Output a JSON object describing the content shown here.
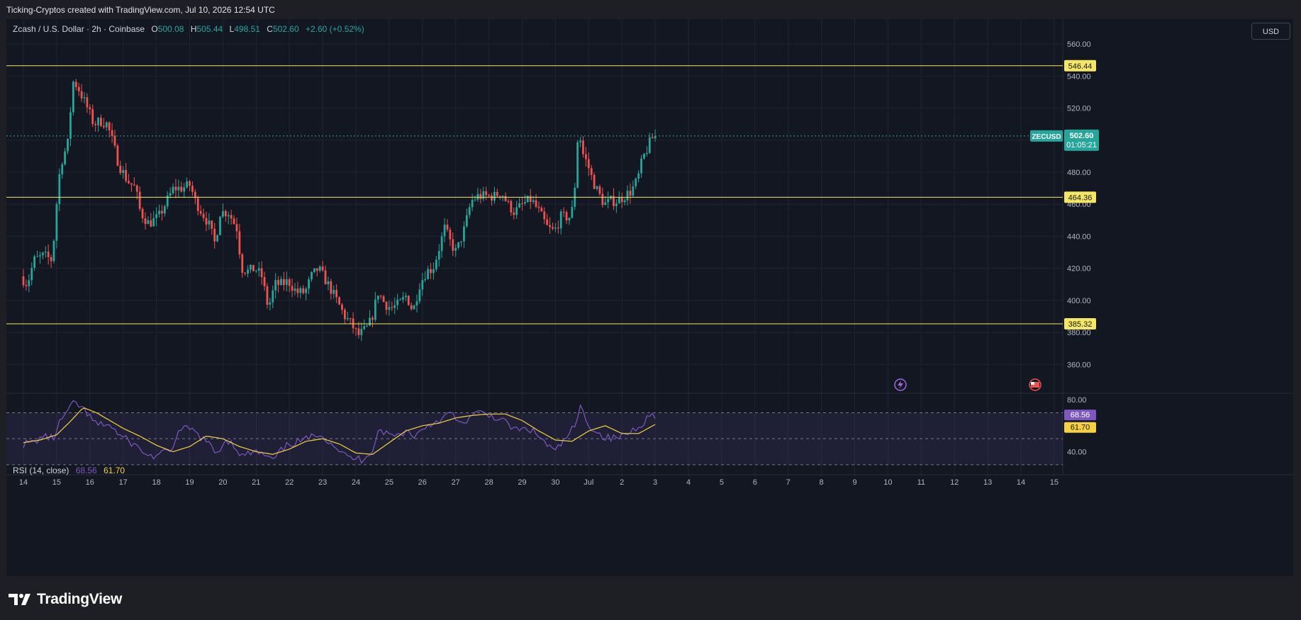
{
  "header": {
    "attribution": "Ticking-Cryptos created with TradingView.com, Jul 10, 2026 12:54 UTC"
  },
  "symbol": {
    "name": "Zcash / U.S. Dollar · 2h · Coinbase",
    "open_label": "O",
    "open": "500.08",
    "high_label": "H",
    "high": "505.44",
    "low_label": "L",
    "low": "498.51",
    "close_label": "C",
    "close": "502.60",
    "change": "+2.60 (+0.52%)",
    "ticker": "ZECUSD",
    "last_price": "502.60",
    "countdown": "01:05:21"
  },
  "currency_button": "USD",
  "footer": {
    "logo_text": "TradingView"
  },
  "colors": {
    "background": "#131722",
    "up": "#26a69a",
    "down": "#ef5350",
    "level_line": "#f5e663",
    "rsi_line": "#7e57c2",
    "rsi_ma": "#f5d142"
  },
  "chart_data": [
    {
      "type": "candlestick",
      "title": "Zcash / U.S. Dollar · 2h · Coinbase",
      "y_ticks": [
        "560.00",
        "540.00",
        "520.00",
        "500.00",
        "480.00",
        "460.00",
        "440.00",
        "420.00",
        "400.00",
        "380.00",
        "360.00"
      ],
      "ylim": [
        342,
        572
      ],
      "x_ticks": [
        "14",
        "15",
        "16",
        "17",
        "18",
        "19",
        "20",
        "21",
        "22",
        "23",
        "24",
        "25",
        "26",
        "27",
        "28",
        "29",
        "30",
        "Jul",
        "2",
        "3",
        "4",
        "5",
        "6",
        "7",
        "8",
        "9",
        "10",
        "11",
        "12",
        "13",
        "14",
        "15"
      ],
      "horizontal_levels": [
        {
          "value": 546.44,
          "label": "546.44"
        },
        {
          "value": 464.36,
          "label": "464.36"
        },
        {
          "value": 385.32,
          "label": "385.32"
        }
      ],
      "last_price": 502.6,
      "price_anchors": [
        [
          0,
          415
        ],
        [
          0.2,
          410
        ],
        [
          0.4,
          425
        ],
        [
          0.7,
          428
        ],
        [
          0.95,
          425
        ],
        [
          1.1,
          465
        ],
        [
          1.2,
          485
        ],
        [
          1.45,
          500
        ],
        [
          1.55,
          537
        ],
        [
          1.7,
          534
        ],
        [
          1.9,
          525
        ],
        [
          2.05,
          518
        ],
        [
          2.2,
          510
        ],
        [
          2.4,
          512
        ],
        [
          2.6,
          510
        ],
        [
          2.75,
          500
        ],
        [
          2.95,
          485
        ],
        [
          3.2,
          475
        ],
        [
          3.45,
          470
        ],
        [
          3.6,
          455
        ],
        [
          3.85,
          448
        ],
        [
          4.15,
          452
        ],
        [
          4.35,
          460
        ],
        [
          4.6,
          470
        ],
        [
          4.85,
          470
        ],
        [
          5.1,
          472
        ],
        [
          5.25,
          462
        ],
        [
          5.45,
          455
        ],
        [
          5.65,
          448
        ],
        [
          5.85,
          435
        ],
        [
          6.0,
          455
        ],
        [
          6.25,
          455
        ],
        [
          6.5,
          445
        ],
        [
          6.65,
          420
        ],
        [
          6.85,
          418
        ],
        [
          7.05,
          420
        ],
        [
          7.25,
          415
        ],
        [
          7.45,
          395
        ],
        [
          7.65,
          410
        ],
        [
          7.85,
          410
        ],
        [
          8.05,
          412
        ],
        [
          8.3,
          405
        ],
        [
          8.55,
          405
        ],
        [
          8.75,
          415
        ],
        [
          8.95,
          420
        ],
        [
          9.1,
          415
        ],
        [
          9.3,
          408
        ],
        [
          9.5,
          400
        ],
        [
          9.75,
          390
        ],
        [
          9.95,
          385
        ],
        [
          10.15,
          378
        ],
        [
          10.4,
          382
        ],
        [
          10.55,
          388
        ],
        [
          10.75,
          405
        ],
        [
          10.95,
          398
        ],
        [
          11.15,
          395
        ],
        [
          11.4,
          398
        ],
        [
          11.6,
          403
        ],
        [
          11.8,
          393
        ],
        [
          12.0,
          410
        ],
        [
          12.2,
          418
        ],
        [
          12.4,
          420
        ],
        [
          12.55,
          430
        ],
        [
          12.75,
          445
        ],
        [
          12.95,
          435
        ],
        [
          13.1,
          430
        ],
        [
          13.35,
          445
        ],
        [
          13.55,
          462
        ],
        [
          13.75,
          465
        ],
        [
          14.0,
          465
        ],
        [
          14.25,
          465
        ],
        [
          14.45,
          468
        ],
        [
          14.65,
          460
        ],
        [
          14.85,
          455
        ],
        [
          15.1,
          460
        ],
        [
          15.35,
          463
        ],
        [
          15.6,
          455
        ],
        [
          15.85,
          445
        ],
        [
          16.05,
          443
        ],
        [
          16.25,
          452
        ],
        [
          16.5,
          452
        ],
        [
          16.65,
          460
        ],
        [
          16.7,
          495
        ],
        [
          16.8,
          505
        ],
        [
          16.9,
          492
        ],
        [
          17.05,
          485
        ],
        [
          17.2,
          475
        ],
        [
          17.35,
          468
        ],
        [
          17.55,
          460
        ],
        [
          17.75,
          462
        ],
        [
          17.95,
          462
        ],
        [
          18.15,
          465
        ],
        [
          18.35,
          468
        ],
        [
          18.55,
          475
        ],
        [
          18.7,
          488
        ],
        [
          18.85,
          495
        ],
        [
          18.95,
          500
        ],
        [
          19.05,
          502.6
        ]
      ],
      "rsi": {
        "label": "RSI (14, close)",
        "value": 68.56,
        "ma_value": 61.7,
        "value_label": "68.56",
        "ma_label": "61.70",
        "y_ticks": [
          "80.00",
          "40.00"
        ],
        "ylim": [
          25,
          85
        ],
        "bands": [
          70,
          50,
          30
        ],
        "anchors": [
          [
            0,
            46
          ],
          [
            0.3,
            47
          ],
          [
            0.6,
            52
          ],
          [
            0.9,
            50
          ],
          [
            1.1,
            63
          ],
          [
            1.3,
            70
          ],
          [
            1.55,
            78
          ],
          [
            1.7,
            75
          ],
          [
            1.9,
            70
          ],
          [
            2.1,
            63
          ],
          [
            2.3,
            60
          ],
          [
            2.5,
            62
          ],
          [
            2.7,
            58
          ],
          [
            2.9,
            52
          ],
          [
            3.2,
            48
          ],
          [
            3.5,
            42
          ],
          [
            3.8,
            36
          ],
          [
            4.1,
            38
          ],
          [
            4.4,
            40
          ],
          [
            4.7,
            56
          ],
          [
            5.0,
            58
          ],
          [
            5.3,
            52
          ],
          [
            5.5,
            48
          ],
          [
            5.8,
            38
          ],
          [
            6.1,
            50
          ],
          [
            6.3,
            46
          ],
          [
            6.6,
            36
          ],
          [
            6.9,
            40
          ],
          [
            7.2,
            38
          ],
          [
            7.5,
            33
          ],
          [
            7.8,
            42
          ],
          [
            8.0,
            46
          ],
          [
            8.3,
            48
          ],
          [
            8.6,
            50
          ],
          [
            8.9,
            55
          ],
          [
            9.1,
            50
          ],
          [
            9.4,
            44
          ],
          [
            9.7,
            36
          ],
          [
            9.9,
            35
          ],
          [
            10.2,
            34
          ],
          [
            10.5,
            42
          ],
          [
            10.7,
            58
          ],
          [
            10.9,
            54
          ],
          [
            11.2,
            52
          ],
          [
            11.5,
            56
          ],
          [
            11.8,
            52
          ],
          [
            12.0,
            58
          ],
          [
            12.3,
            62
          ],
          [
            12.6,
            66
          ],
          [
            12.9,
            70
          ],
          [
            13.1,
            60
          ],
          [
            13.4,
            66
          ],
          [
            13.7,
            70
          ],
          [
            14.0,
            68
          ],
          [
            14.3,
            66
          ],
          [
            14.6,
            60
          ],
          [
            14.9,
            56
          ],
          [
            15.2,
            58
          ],
          [
            15.5,
            52
          ],
          [
            15.8,
            44
          ],
          [
            16.0,
            40
          ],
          [
            16.3,
            50
          ],
          [
            16.6,
            60
          ],
          [
            16.75,
            74
          ],
          [
            16.9,
            66
          ],
          [
            17.1,
            58
          ],
          [
            17.4,
            52
          ],
          [
            17.7,
            50
          ],
          [
            18.0,
            52
          ],
          [
            18.3,
            56
          ],
          [
            18.6,
            62
          ],
          [
            18.85,
            68
          ],
          [
            19.05,
            68.56
          ]
        ],
        "ma_anchors": [
          [
            0,
            47
          ],
          [
            0.5,
            49
          ],
          [
            1.0,
            53
          ],
          [
            1.4,
            63
          ],
          [
            1.8,
            74
          ],
          [
            2.2,
            70
          ],
          [
            2.6,
            64
          ],
          [
            3.0,
            58
          ],
          [
            3.5,
            52
          ],
          [
            4.0,
            45
          ],
          [
            4.5,
            40
          ],
          [
            5.0,
            44
          ],
          [
            5.5,
            52
          ],
          [
            6.0,
            50
          ],
          [
            6.5,
            44
          ],
          [
            7.0,
            40
          ],
          [
            7.5,
            38
          ],
          [
            8.0,
            42
          ],
          [
            8.5,
            48
          ],
          [
            9.0,
            50
          ],
          [
            9.5,
            46
          ],
          [
            10.0,
            39
          ],
          [
            10.5,
            38
          ],
          [
            11.0,
            47
          ],
          [
            11.5,
            56
          ],
          [
            12.0,
            60
          ],
          [
            12.5,
            62
          ],
          [
            13.0,
            66
          ],
          [
            13.5,
            68
          ],
          [
            14.0,
            69
          ],
          [
            14.5,
            69
          ],
          [
            15.0,
            64
          ],
          [
            15.5,
            56
          ],
          [
            16.0,
            49
          ],
          [
            16.5,
            48
          ],
          [
            17.0,
            56
          ],
          [
            17.5,
            60
          ],
          [
            18.0,
            54
          ],
          [
            18.5,
            54
          ],
          [
            19.05,
            61.7
          ]
        ]
      }
    }
  ]
}
